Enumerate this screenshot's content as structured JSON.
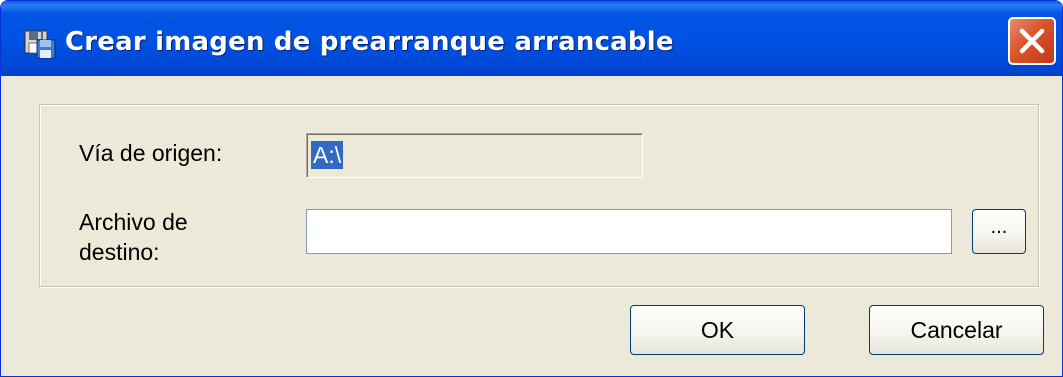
{
  "window": {
    "title": "Crear imagen de prearranque arrancable",
    "app_icon": "disk-image-app-icon",
    "close_icon": "close-icon"
  },
  "form": {
    "source_label": "Vía de origen:",
    "source_value": "A:\\",
    "destination_label": "Archivo de destino:",
    "destination_value": "",
    "browse_label": "..."
  },
  "buttons": {
    "ok": "OK",
    "cancel": "Cancelar"
  },
  "colors": {
    "titlebar": "#0054e3",
    "dialog_bg": "#ece9d8",
    "close_button": "#d9532b",
    "selection": "#316ac5"
  }
}
